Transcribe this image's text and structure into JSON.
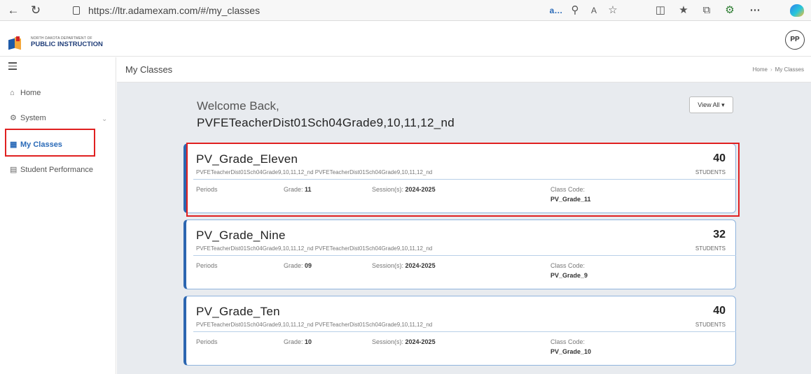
{
  "browser": {
    "url": "https://ltr.adamexam.com/#/my_classes",
    "icons": [
      "back-arrow",
      "refresh",
      "lock",
      "read-aloud",
      "zoom-out",
      "text-size",
      "favorite-star",
      "split-screen",
      "favorites",
      "collections",
      "extensions",
      "more",
      "copilot"
    ]
  },
  "header": {
    "logo_small": "NORTH DAKOTA DEPARTMENT OF",
    "logo_big": "PUBLIC INSTRUCTION",
    "avatar_initials": "PP"
  },
  "sidebar": {
    "items": [
      {
        "label": "Home",
        "icon": "home-icon"
      },
      {
        "label": "System",
        "icon": "gear-icon"
      },
      {
        "label": "My Classes",
        "icon": "classes-icon"
      },
      {
        "label": "Student Performance",
        "icon": "chart-icon"
      }
    ]
  },
  "main": {
    "title": "My Classes",
    "breadcrumb": [
      "Home",
      "My Classes"
    ],
    "welcome": "Welcome Back,",
    "teacher": "PVFETeacherDist01Sch04Grade9,10,11,12_nd",
    "view_all": "View All",
    "labels": {
      "periods": "Periods",
      "grade": "Grade:",
      "session": "Session(s):",
      "class_code": "Class Code:",
      "students": "STUDENTS"
    },
    "classes": [
      {
        "name": "PV_Grade_Eleven",
        "teachers": "PVFETeacherDist01Sch04Grade9,10,11,12_nd PVFETeacherDist01Sch04Grade9,10,11,12_nd",
        "count": "40",
        "grade": "11",
        "session": "2024-2025",
        "code": "PV_Grade_11"
      },
      {
        "name": "PV_Grade_Nine",
        "teachers": "PVFETeacherDist01Sch04Grade9,10,11,12_nd PVFETeacherDist01Sch04Grade9,10,11,12_nd",
        "count": "32",
        "grade": "09",
        "session": "2024-2025",
        "code": "PV_Grade_9"
      },
      {
        "name": "PV_Grade_Ten",
        "teachers": "PVFETeacherDist01Sch04Grade9,10,11,12_nd PVFETeacherDist01Sch04Grade9,10,11,12_nd",
        "count": "40",
        "grade": "10",
        "session": "2024-2025",
        "code": "PV_Grade_10"
      }
    ]
  },
  "colors": {
    "accent": "#2c66b0",
    "highlight": "#e02020"
  }
}
